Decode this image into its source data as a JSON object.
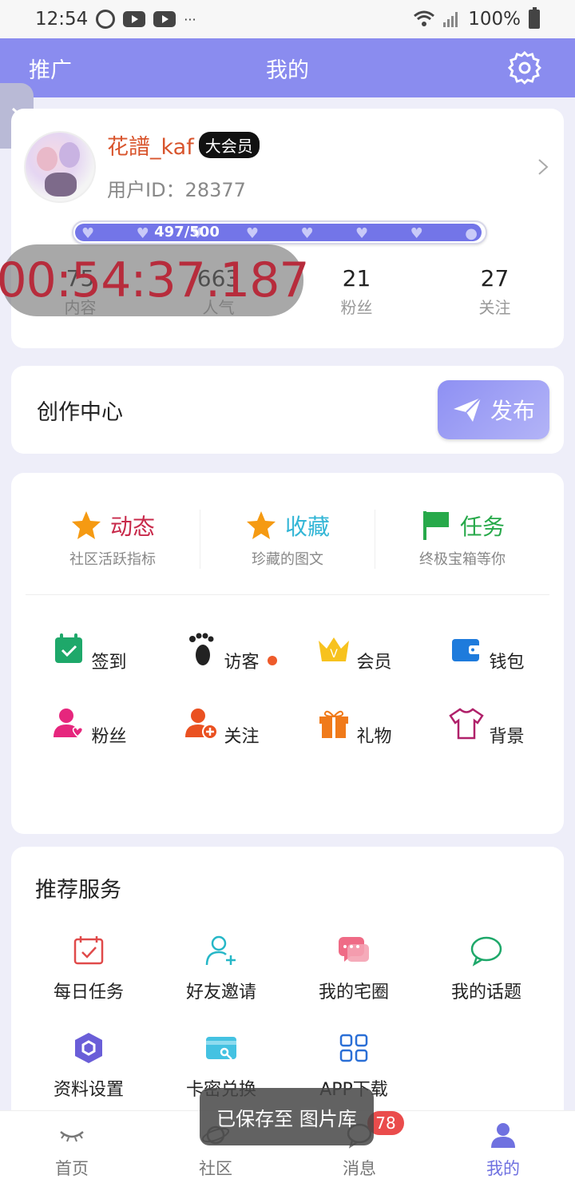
{
  "status_bar": {
    "time": "12:54",
    "more": "···",
    "battery": "100%"
  },
  "header": {
    "left": "推广",
    "title": "我的"
  },
  "profile": {
    "username": "花譜_kaf",
    "vip": "大会员",
    "user_id": "用户ID：28377",
    "level_text": "497/500",
    "level_progress": 0.994,
    "stats": [
      {
        "num": "75",
        "label": "内容"
      },
      {
        "num": "663",
        "label": "人气"
      },
      {
        "num": "21",
        "label": "粉丝"
      },
      {
        "num": "27",
        "label": "关注"
      }
    ]
  },
  "timer_overlay": "00:54:37.187",
  "create": {
    "title": "创作中心",
    "publish": "发布"
  },
  "top_items": [
    {
      "title": "动态",
      "sub": "社区活跃指标",
      "color": "#c8294a"
    },
    {
      "title": "收藏",
      "sub": "珍藏的图文",
      "color": "#33b6d6"
    },
    {
      "title": "任务",
      "sub": "终极宝箱等你",
      "color": "#27a94a"
    }
  ],
  "grid_items": [
    {
      "label": "签到"
    },
    {
      "label": "访客"
    },
    {
      "label": "会员"
    },
    {
      "label": "钱包"
    },
    {
      "label": "粉丝"
    },
    {
      "label": "关注"
    },
    {
      "label": "礼物"
    },
    {
      "label": "背景"
    }
  ],
  "services": {
    "title": "推荐服务",
    "items": [
      {
        "label": "每日任务"
      },
      {
        "label": "好友邀请"
      },
      {
        "label": "我的宅圈"
      },
      {
        "label": "我的话题"
      },
      {
        "label": "资料设置"
      },
      {
        "label": "卡密兑换"
      },
      {
        "label": "APP下载"
      }
    ]
  },
  "toast": "已保存至 图片库",
  "tabbar": {
    "items": [
      {
        "label": "首页"
      },
      {
        "label": "社区"
      },
      {
        "label": "消息"
      },
      {
        "label": "我的"
      }
    ],
    "message_badge": "78"
  }
}
